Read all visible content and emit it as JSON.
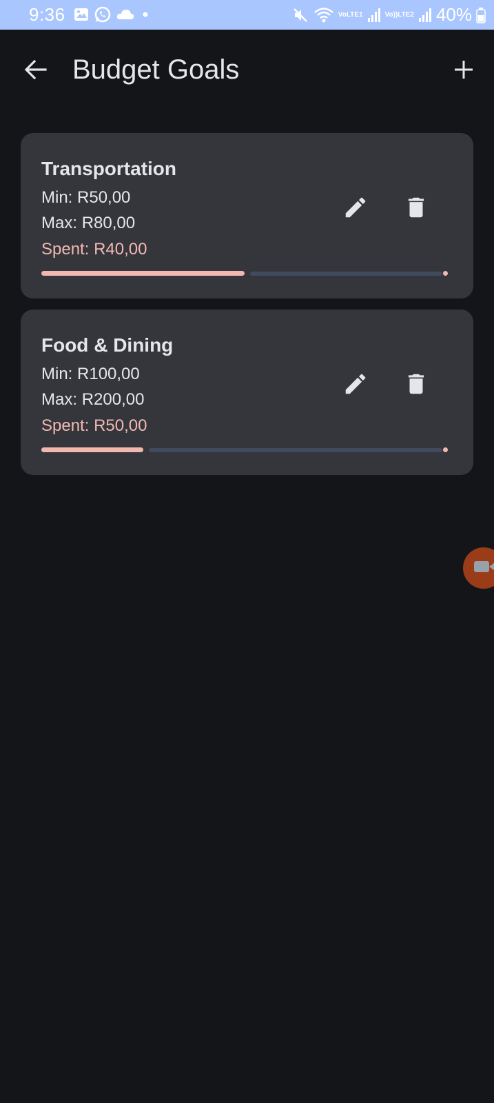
{
  "status_bar": {
    "time": "9:36",
    "battery_percent": "40%",
    "sim1_label_top": "Vo",
    "sim1_label_bottom": "LTE1",
    "sim2_label_top": "Vo))",
    "sim2_label_bottom": "LTE2",
    "icons": [
      "gallery-icon",
      "whatsapp-icon",
      "cloud-icon",
      "dot-icon",
      "mute-icon",
      "wifi-icon",
      "signal-icon",
      "battery-icon"
    ],
    "bar_color": "#aac6ff"
  },
  "app_bar": {
    "title": "Budget Goals",
    "back_icon": "arrow-back-icon",
    "add_icon": "add-icon"
  },
  "goals": [
    {
      "name": "Transportation",
      "min_label": "Min: ",
      "min_value": "R50,00",
      "max_label": "Max: ",
      "max_value": "R80,00",
      "spent_label": "Spent: ",
      "spent_value": "R40,00",
      "progress_fraction": 0.5
    },
    {
      "name": "Food & Dining",
      "min_label": "Min: ",
      "min_value": "R100,00",
      "max_label": "Max: ",
      "max_value": "R200,00",
      "spent_label": "Spent: ",
      "spent_value": "R50,00",
      "progress_fraction": 0.25
    }
  ],
  "colors": {
    "background": "#141518",
    "card": "#35363c",
    "accent": "#f2b8b0",
    "track": "#414a5e",
    "text": "#e6e6ea",
    "floating_bubble": "#9a3c18"
  },
  "floating_bubble_icon": "video-camera-icon"
}
